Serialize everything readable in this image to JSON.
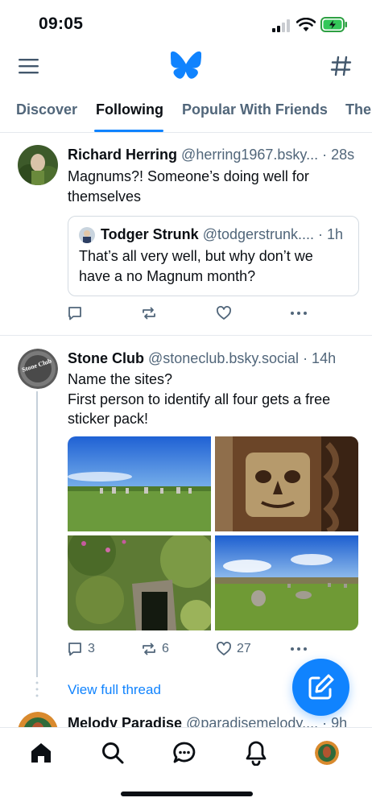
{
  "status_bar": {
    "time": "09:05"
  },
  "header": {
    "menu_icon": "hamburger-menu-icon",
    "logo": "butterfly-logo-icon",
    "feeds_icon": "hash-icon"
  },
  "tabs": [
    {
      "label": "Discover"
    },
    {
      "label": "Following",
      "active": true
    },
    {
      "label": "Popular With Friends"
    },
    {
      "label": "The"
    }
  ],
  "posts": [
    {
      "display_name": "Richard Herring",
      "handle": "@herring1967.bsky...",
      "time": "· 28s",
      "text_lines": [
        "Magnums?! Someone’s doing well for",
        "themselves"
      ],
      "quote": {
        "display_name": "Todger Strunk",
        "handle": "@todgerstrunk....",
        "time": "· 1h",
        "text_lines": [
          "That’s all very well, but why don’t we",
          "have a no Magnum month?"
        ]
      },
      "actions": {
        "replies": "",
        "reposts": "",
        "likes": ""
      }
    },
    {
      "display_name": "Stone Club",
      "handle": "@stoneclub.bsky.social",
      "time": "· 14h",
      "avatar_text": "Stone Club",
      "text_lines": [
        "Name the sites?",
        "First person to identify all four gets  a free",
        "sticker pack!"
      ],
      "images": [
        "stone-circle-field",
        "carved-wooden-face",
        "overgrown-stone-entrance",
        "stones-on-moorland"
      ],
      "actions": {
        "replies": "3",
        "reposts": "6",
        "likes": "27"
      },
      "view_thread": "View full thread"
    },
    {
      "display_name": "Melody Paradise",
      "handle": "@paradisemelody....",
      "time": "· 9h"
    }
  ],
  "fab": {
    "icon": "compose-icon"
  },
  "tabbar": {
    "items": [
      "home-icon",
      "search-icon",
      "chat-icon",
      "bell-icon",
      "profile-avatar"
    ]
  }
}
